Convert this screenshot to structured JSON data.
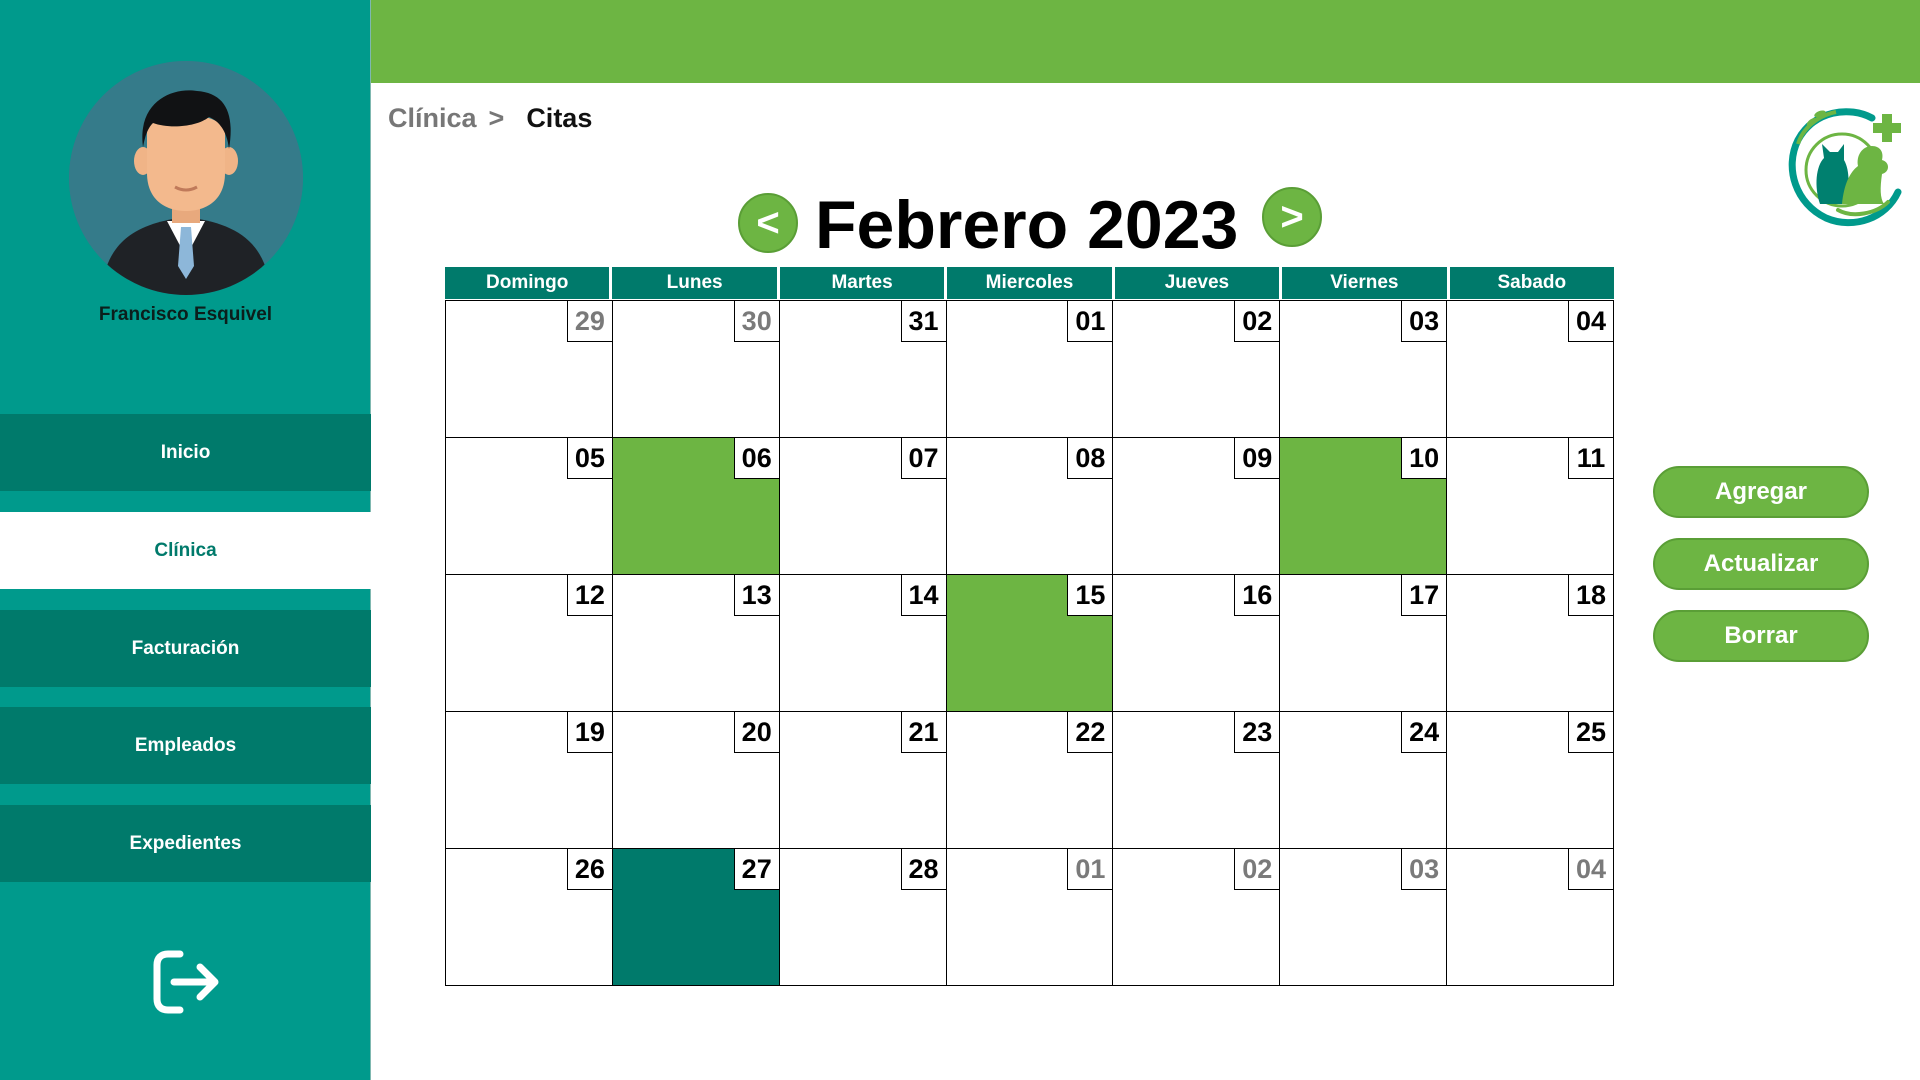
{
  "user": {
    "name": "Francisco Esquivel"
  },
  "sidebar": {
    "items": [
      {
        "label": "Inicio",
        "active": false
      },
      {
        "label": "Clínica",
        "active": true
      },
      {
        "label": "Facturación",
        "active": false
      },
      {
        "label": "Empleados",
        "active": false
      },
      {
        "label": "Expedientes",
        "active": false
      }
    ],
    "logout_icon": "logout-icon"
  },
  "breadcrumb": {
    "root": "Clínica",
    "separator": ">",
    "current": "Citas"
  },
  "calendar": {
    "prev_label": "<",
    "next_label": ">",
    "month_title": "Febrero 2023",
    "weekdays": [
      "Domingo",
      "Lunes",
      "Martes",
      "Miercoles",
      "Jueves",
      "Viernes",
      "Sabado"
    ],
    "days": [
      {
        "label": "29",
        "other": true
      },
      {
        "label": "30",
        "other": true
      },
      {
        "label": "31",
        "other": false
      },
      {
        "label": "01",
        "other": false
      },
      {
        "label": "02",
        "other": false
      },
      {
        "label": "03",
        "other": false
      },
      {
        "label": "04",
        "other": false
      },
      {
        "label": "05",
        "other": false
      },
      {
        "label": "06",
        "other": false,
        "highlight": "green"
      },
      {
        "label": "07",
        "other": false
      },
      {
        "label": "08",
        "other": false
      },
      {
        "label": "09",
        "other": false
      },
      {
        "label": "10",
        "other": false,
        "highlight": "green"
      },
      {
        "label": "11",
        "other": false
      },
      {
        "label": "12",
        "other": false
      },
      {
        "label": "13",
        "other": false
      },
      {
        "label": "14",
        "other": false
      },
      {
        "label": "15",
        "other": false,
        "highlight": "green"
      },
      {
        "label": "16",
        "other": false
      },
      {
        "label": "17",
        "other": false
      },
      {
        "label": "18",
        "other": false
      },
      {
        "label": "19",
        "other": false
      },
      {
        "label": "20",
        "other": false
      },
      {
        "label": "21",
        "other": false
      },
      {
        "label": "22",
        "other": false
      },
      {
        "label": "23",
        "other": false
      },
      {
        "label": "24",
        "other": false
      },
      {
        "label": "25",
        "other": false
      },
      {
        "label": "26",
        "other": false
      },
      {
        "label": "27",
        "other": false,
        "highlight": "teal"
      },
      {
        "label": "28",
        "other": false
      },
      {
        "label": "01",
        "other": true
      },
      {
        "label": "02",
        "other": true
      },
      {
        "label": "03",
        "other": true
      },
      {
        "label": "04",
        "other": true
      }
    ]
  },
  "actions": {
    "add_label": "Agregar",
    "update_label": "Actualizar",
    "delete_label": "Borrar"
  },
  "colors": {
    "teal": "#009a8c",
    "dark_teal": "#007a6b",
    "green": "#6db543"
  }
}
